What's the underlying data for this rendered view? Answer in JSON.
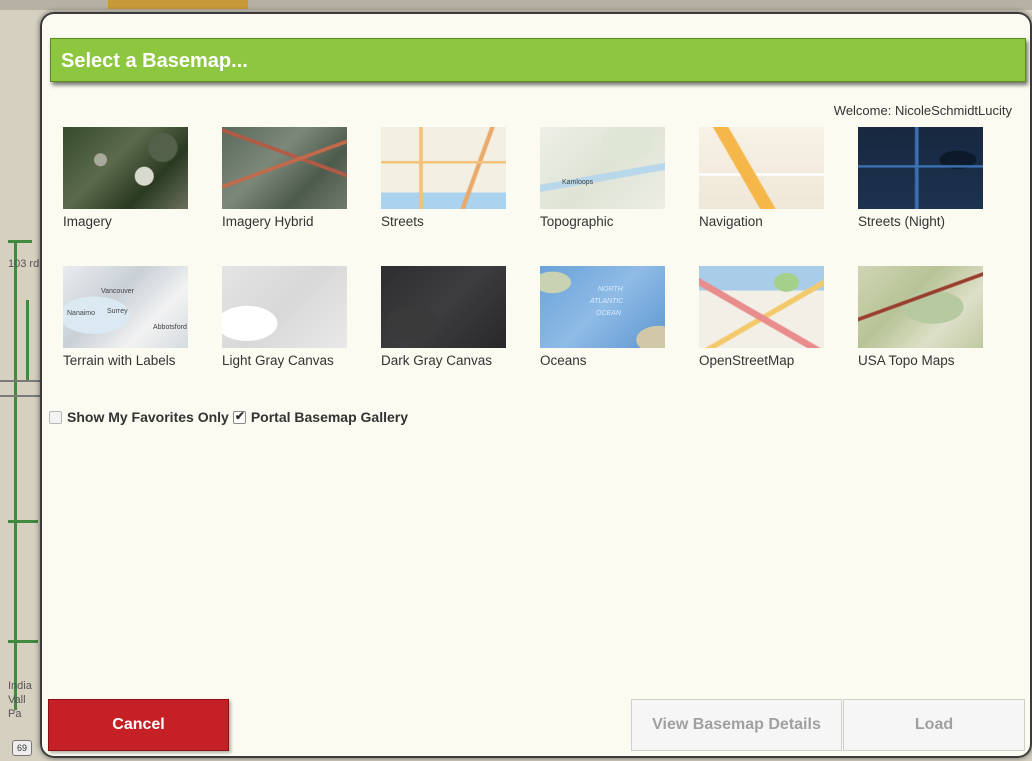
{
  "dialog": {
    "title": "Select a Basemap...",
    "welcome": "Welcome: NicoleSchmidtLucity"
  },
  "background_map": {
    "labels": [
      "103 rd",
      "India",
      "Vall",
      "Pa"
    ],
    "route_shield": "69"
  },
  "basemaps": [
    {
      "label": "Imagery",
      "thumb": "t-imagery"
    },
    {
      "label": "Imagery Hybrid",
      "thumb": "t-hybrid"
    },
    {
      "label": "Streets",
      "thumb": "t-streets"
    },
    {
      "label": "Topographic",
      "thumb": "t-topo"
    },
    {
      "label": "Navigation",
      "thumb": "t-nav"
    },
    {
      "label": "Streets (Night)",
      "thumb": "t-night"
    },
    {
      "label": "Terrain with Labels",
      "thumb": "t-terrain"
    },
    {
      "label": "Light Gray Canvas",
      "thumb": "t-lightgray"
    },
    {
      "label": "Dark Gray Canvas",
      "thumb": "t-darkgray"
    },
    {
      "label": "Oceans",
      "thumb": "t-oceans"
    },
    {
      "label": "OpenStreetMap",
      "thumb": "t-osm"
    },
    {
      "label": "USA Topo Maps",
      "thumb": "t-usatopo"
    }
  ],
  "thumbnail_text": {
    "terrain": [
      "Vancouver",
      "Nanaimo",
      "Surrey",
      "Abbotsford"
    ],
    "oceans": [
      "NORTH",
      "ATLANTIC",
      "OCEAN"
    ],
    "topo": [
      "Kamloops"
    ]
  },
  "options": {
    "favorites_label": "Show My Favorites Only",
    "favorites_checked": false,
    "portal_label": "Portal Basemap Gallery",
    "portal_checked": true
  },
  "buttons": {
    "cancel": "Cancel",
    "details": "View Basemap Details",
    "load": "Load"
  },
  "colors": {
    "title_bar": "#8dc63f",
    "cancel": "#c42025",
    "disabled_button": "#f6f6f6"
  }
}
